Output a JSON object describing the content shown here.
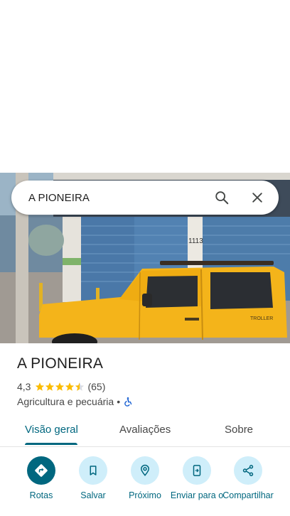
{
  "search": {
    "query": "A PIONEIRA"
  },
  "place": {
    "name": "A PIONEIRA",
    "rating": "4,3",
    "rating_value": 4.3,
    "reviews_count": "(65)",
    "category": "Agricultura e pecuária",
    "separator": "•"
  },
  "photo": {
    "house_number": "1113",
    "car_text": "TROLLER"
  },
  "tabs": [
    {
      "label": "Visão geral",
      "active": true
    },
    {
      "label": "Avaliações",
      "active": false
    },
    {
      "label": "Sobre",
      "active": false
    }
  ],
  "actions": [
    {
      "label": "Rotas",
      "icon": "directions-icon"
    },
    {
      "label": "Salvar",
      "icon": "bookmark-icon"
    },
    {
      "label": "Próximo",
      "icon": "nearby-icon"
    },
    {
      "label": "Enviar para o",
      "icon": "send-to-phone-icon"
    },
    {
      "label": "Compartilhar",
      "icon": "share-icon"
    }
  ],
  "colors": {
    "accent": "#00677f",
    "action_bg": "#cfeefa",
    "star": "#fbbc04",
    "car": "#f4b41a"
  }
}
